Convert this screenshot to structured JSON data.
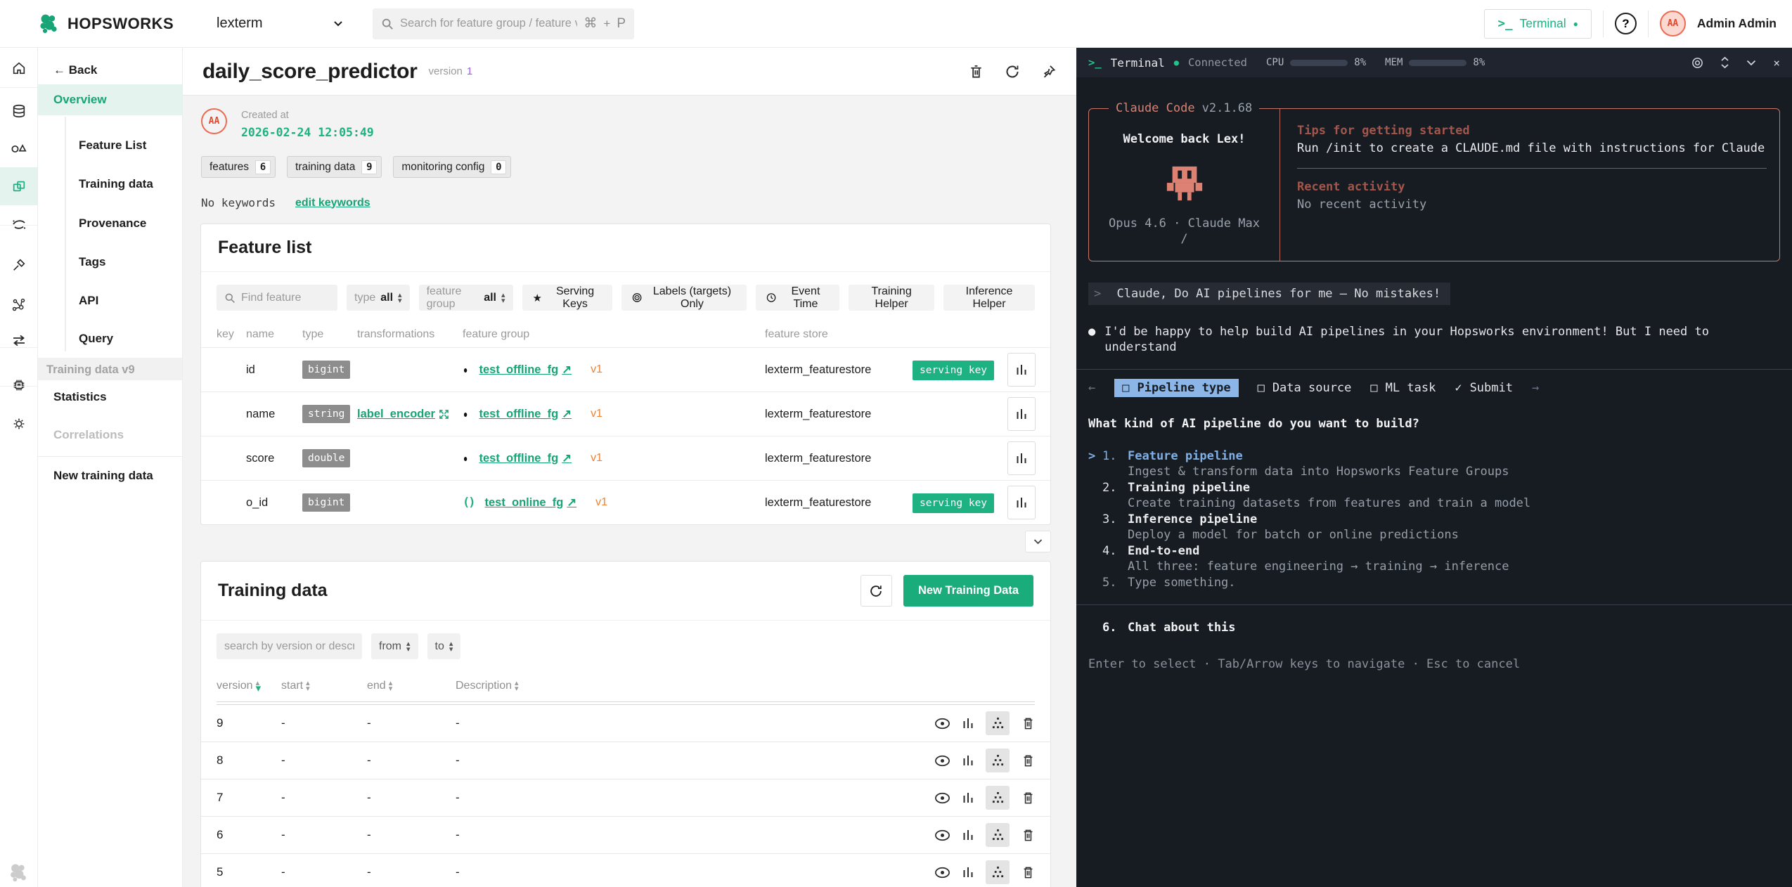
{
  "brand": {
    "name": "HOPSWORKS"
  },
  "icons": {
    "back_arrow": "←",
    "cmd": "⌘",
    "plus": "+",
    "p_key": "P",
    "prompt": ">_",
    "dot": "●",
    "question_mark": "?",
    "star": "★",
    "offline": "●",
    "online": "()",
    "external": "↗",
    "sort_up": "▴",
    "sort_down": "▾",
    "left_arrow": "←",
    "right_arrow": "→",
    "checkbox": "□",
    "check": "✓",
    "bullet": "●",
    "caret": ">",
    "close": "×",
    "user_prefix": ">"
  },
  "header": {
    "project": "lexterm",
    "search_placeholder": "Search for feature group / feature view",
    "terminal_button": "Terminal",
    "user_name": "Admin Admin",
    "user_initials": "AA"
  },
  "sidebar": {
    "back_label": "Back",
    "overview": "Overview",
    "items": [
      "Feature List",
      "Training data",
      "Provenance",
      "Tags",
      "API",
      "Query"
    ],
    "group_label": "Training data v9",
    "statistics": "Statistics",
    "correlations": "Correlations",
    "new_training_data": "New training data"
  },
  "overview": {
    "title": "daily_score_predictor",
    "version_label": "version",
    "version_value": "1",
    "avatar_initials": "AA",
    "created_label": "Created at",
    "created_value": "2026-02-24 12:05:49",
    "badges": [
      {
        "label": "features",
        "count": "6"
      },
      {
        "label": "training data",
        "count": "9"
      },
      {
        "label": "monitoring config",
        "count": "0"
      }
    ],
    "keywords_text": "No keywords",
    "keywords_link": "edit keywords"
  },
  "feature_list": {
    "title": "Feature list",
    "search_placeholder": "Find feature",
    "type_label": "type",
    "type_value": "all",
    "fg_label": "feature group",
    "fg_value": "all",
    "serving_keys_button": "Serving Keys",
    "labels_button": "Labels (targets) Only",
    "event_time_button": "Event Time",
    "training_helper_button": "Training Helper",
    "inference_helper_button": "Inference Helper",
    "columns": {
      "key": "key",
      "name": "name",
      "type": "type",
      "transformations": "transformations",
      "feature_group": "feature group",
      "feature_store": "feature store"
    },
    "serving_key_badge": "serving key",
    "rows": [
      {
        "name": "id",
        "type": "bigint",
        "fg_name": "test_offline_fg",
        "fg_version": "v1",
        "store": "lexterm_featurestore"
      },
      {
        "name": "name",
        "type": "string",
        "transformation": "label_encoder",
        "fg_name": "test_offline_fg",
        "fg_version": "v1",
        "store": "lexterm_featurestore"
      },
      {
        "name": "score",
        "type": "double",
        "fg_name": "test_offline_fg",
        "fg_version": "v1",
        "store": "lexterm_featurestore"
      },
      {
        "name": "o_id",
        "type": "bigint",
        "fg_name": "test_online_fg",
        "fg_version": "v1",
        "store": "lexterm_featurestore"
      }
    ]
  },
  "training_data": {
    "title": "Training data",
    "new_button": "New Training Data",
    "search_placeholder": "search by version or descript",
    "from_label": "from",
    "to_label": "to",
    "columns": {
      "version": "version",
      "start": "start",
      "end": "end",
      "description": "Description"
    },
    "rows": [
      {
        "version": "9",
        "start": "-",
        "end": "-",
        "description": "-"
      },
      {
        "version": "8",
        "start": "-",
        "end": "-",
        "description": "-"
      },
      {
        "version": "7",
        "start": "-",
        "end": "-",
        "description": "-"
      },
      {
        "version": "6",
        "start": "-",
        "end": "-",
        "description": "-"
      },
      {
        "version": "5",
        "start": "-",
        "end": "-",
        "description": "-"
      }
    ]
  },
  "terminal": {
    "header": {
      "title": "Terminal",
      "status": "Connected",
      "cpu_label": "CPU",
      "cpu_value": "8%",
      "mem_label": "MEM",
      "mem_value": "8%"
    },
    "welcome": {
      "app": "Claude Code",
      "version": "v2.1.68",
      "greeting": "Welcome back Lex!",
      "model_line": "Opus 4.6 · Claude Max",
      "cursor": "/",
      "tips_title": "Tips for getting started",
      "tips_body": "Run /init to create a CLAUDE.md file with instructions for Claude",
      "recent_title": "Recent activity",
      "recent_body": "No recent activity"
    },
    "user_message": "Claude, Do AI pipelines for me — No mistakes!",
    "assistant_message": "I'd be happy to help build AI pipelines in your Hopsworks environment! But I need to understand",
    "steps": [
      {
        "label": "Pipeline type"
      },
      {
        "label": "Data source"
      },
      {
        "label": "ML task"
      },
      {
        "label": "Submit"
      }
    ],
    "question": "What kind of AI pipeline do you want to build?",
    "options": [
      {
        "num": "1.",
        "title": "Feature pipeline",
        "desc": "Ingest & transform data into Hopsworks Feature Groups"
      },
      {
        "num": "2.",
        "title": "Training pipeline",
        "desc": "Create training datasets from features and train a model"
      },
      {
        "num": "3.",
        "title": "Inference pipeline",
        "desc": "Deploy a model for batch or online predictions"
      },
      {
        "num": "4.",
        "title": "End-to-end",
        "desc": "All three: feature engineering → training → inference"
      },
      {
        "num": "5.",
        "title": "Type something."
      }
    ],
    "chat_option": {
      "num": "6.",
      "title": "Chat about this"
    },
    "hint": "Enter to select · Tab/Arrow keys to navigate · Esc to cancel"
  }
}
